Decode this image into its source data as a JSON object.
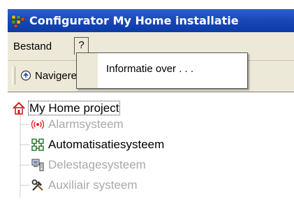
{
  "window": {
    "title": "Configurator My Home installatie"
  },
  "menubar": {
    "items": [
      {
        "label": "Bestand"
      },
      {
        "label": "?"
      }
    ]
  },
  "toolbar": {
    "nav_button_label": "Navigeren"
  },
  "dropdown": {
    "items": [
      {
        "label": "Informatie over . . ."
      }
    ]
  },
  "tree": {
    "root": {
      "label": "My Home project",
      "icon": "house-icon"
    },
    "children": [
      {
        "label": "Alarmsysteem",
        "icon": "alarm-icon",
        "enabled": false
      },
      {
        "label": "Automatisatiesysteem",
        "icon": "automation-icon",
        "enabled": true
      },
      {
        "label": "Delestagesysteem",
        "icon": "load-shedding-icon",
        "enabled": false
      },
      {
        "label": "Auxiliair systeem",
        "icon": "tools-icon",
        "enabled": false
      }
    ]
  },
  "colors": {
    "titlebar": "#0c3aa6",
    "window_bg": "#ece9d8",
    "disabled_text": "#a9a9a9"
  }
}
